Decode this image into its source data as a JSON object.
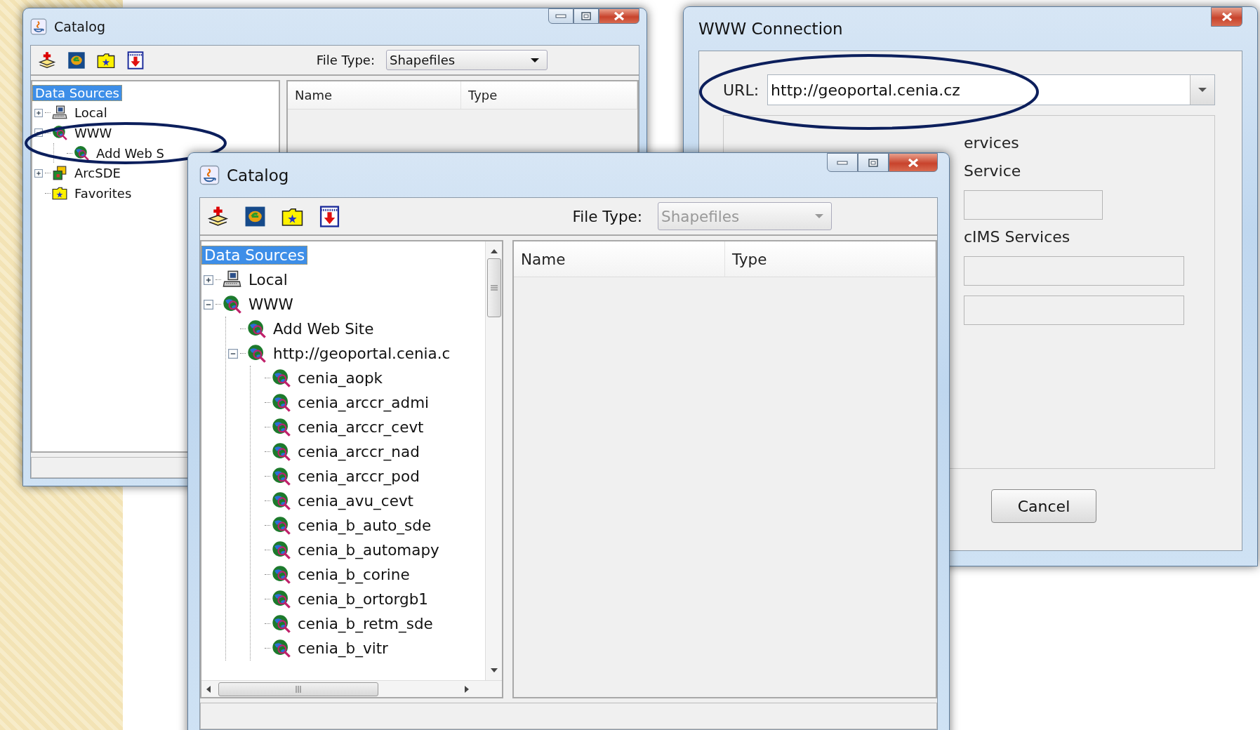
{
  "background_catalog": {
    "title": "Catalog",
    "file_type": {
      "label": "File Type:",
      "value": "Shapefiles",
      "disabled": false
    },
    "tree": {
      "label": "Data Sources",
      "selected": true,
      "children": [
        {
          "label": "Local",
          "kind": "computer",
          "expanded": false,
          "selected": false
        },
        {
          "label": "WWW",
          "kind": "globe",
          "expanded": true,
          "selected": false,
          "children": [
            {
              "label": "Add Web S",
              "kind": "globe",
              "selected": false
            }
          ]
        },
        {
          "label": "ArcSDE",
          "kind": "database",
          "expanded": false,
          "selected": false
        },
        {
          "label": "Favorites",
          "kind": "favorites",
          "selected": false
        }
      ]
    },
    "columns": [
      "Name",
      "Type"
    ]
  },
  "www_connection": {
    "title": "WWW Connection",
    "url_label": "URL:",
    "url": "http://geoportal.cenia.cz",
    "sections": [
      {
        "label": "ervices"
      },
      {
        "label": "Service"
      },
      {
        "label": "cIMS Services"
      }
    ],
    "cancel": "Cancel"
  },
  "catalog": {
    "title": "Catalog",
    "file_type": {
      "label": "File Type:",
      "value": "Shapefiles",
      "disabled": true
    },
    "tree": {
      "label": "Data Sources",
      "selected": true,
      "children": [
        {
          "label": "Local",
          "kind": "computer",
          "expanded": false,
          "selected": false
        },
        {
          "label": "WWW",
          "kind": "globe",
          "expanded": true,
          "selected": false,
          "children": [
            {
              "label": "Add Web Site",
              "kind": "globe",
              "selected": false
            },
            {
              "label": "http://geoportal.cenia.c",
              "kind": "globe",
              "expanded": true,
              "selected": false,
              "children": [
                {
                  "label": "cenia_aopk",
                  "kind": "globe",
                  "selected": false
                },
                {
                  "label": "cenia_arccr_admi",
                  "kind": "globe",
                  "selected": false
                },
                {
                  "label": "cenia_arccr_cevt",
                  "kind": "globe",
                  "selected": false
                },
                {
                  "label": "cenia_arccr_nad",
                  "kind": "globe",
                  "selected": false
                },
                {
                  "label": "cenia_arccr_pod",
                  "kind": "globe",
                  "selected": false
                },
                {
                  "label": "cenia_avu_cevt",
                  "kind": "globe",
                  "selected": false
                },
                {
                  "label": "cenia_b_auto_sde",
                  "kind": "globe",
                  "selected": false
                },
                {
                  "label": "cenia_b_automapy",
                  "kind": "globe",
                  "selected": false
                },
                {
                  "label": "cenia_b_corine",
                  "kind": "globe",
                  "selected": false
                },
                {
                  "label": "cenia_b_ortorgb1",
                  "kind": "globe",
                  "selected": false
                },
                {
                  "label": "cenia_b_retm_sde",
                  "kind": "globe",
                  "selected": false
                },
                {
                  "label": "cenia_b_vitr",
                  "kind": "globe",
                  "selected": false
                }
              ]
            }
          ]
        }
      ]
    },
    "columns": [
      "Name",
      "Type"
    ]
  }
}
